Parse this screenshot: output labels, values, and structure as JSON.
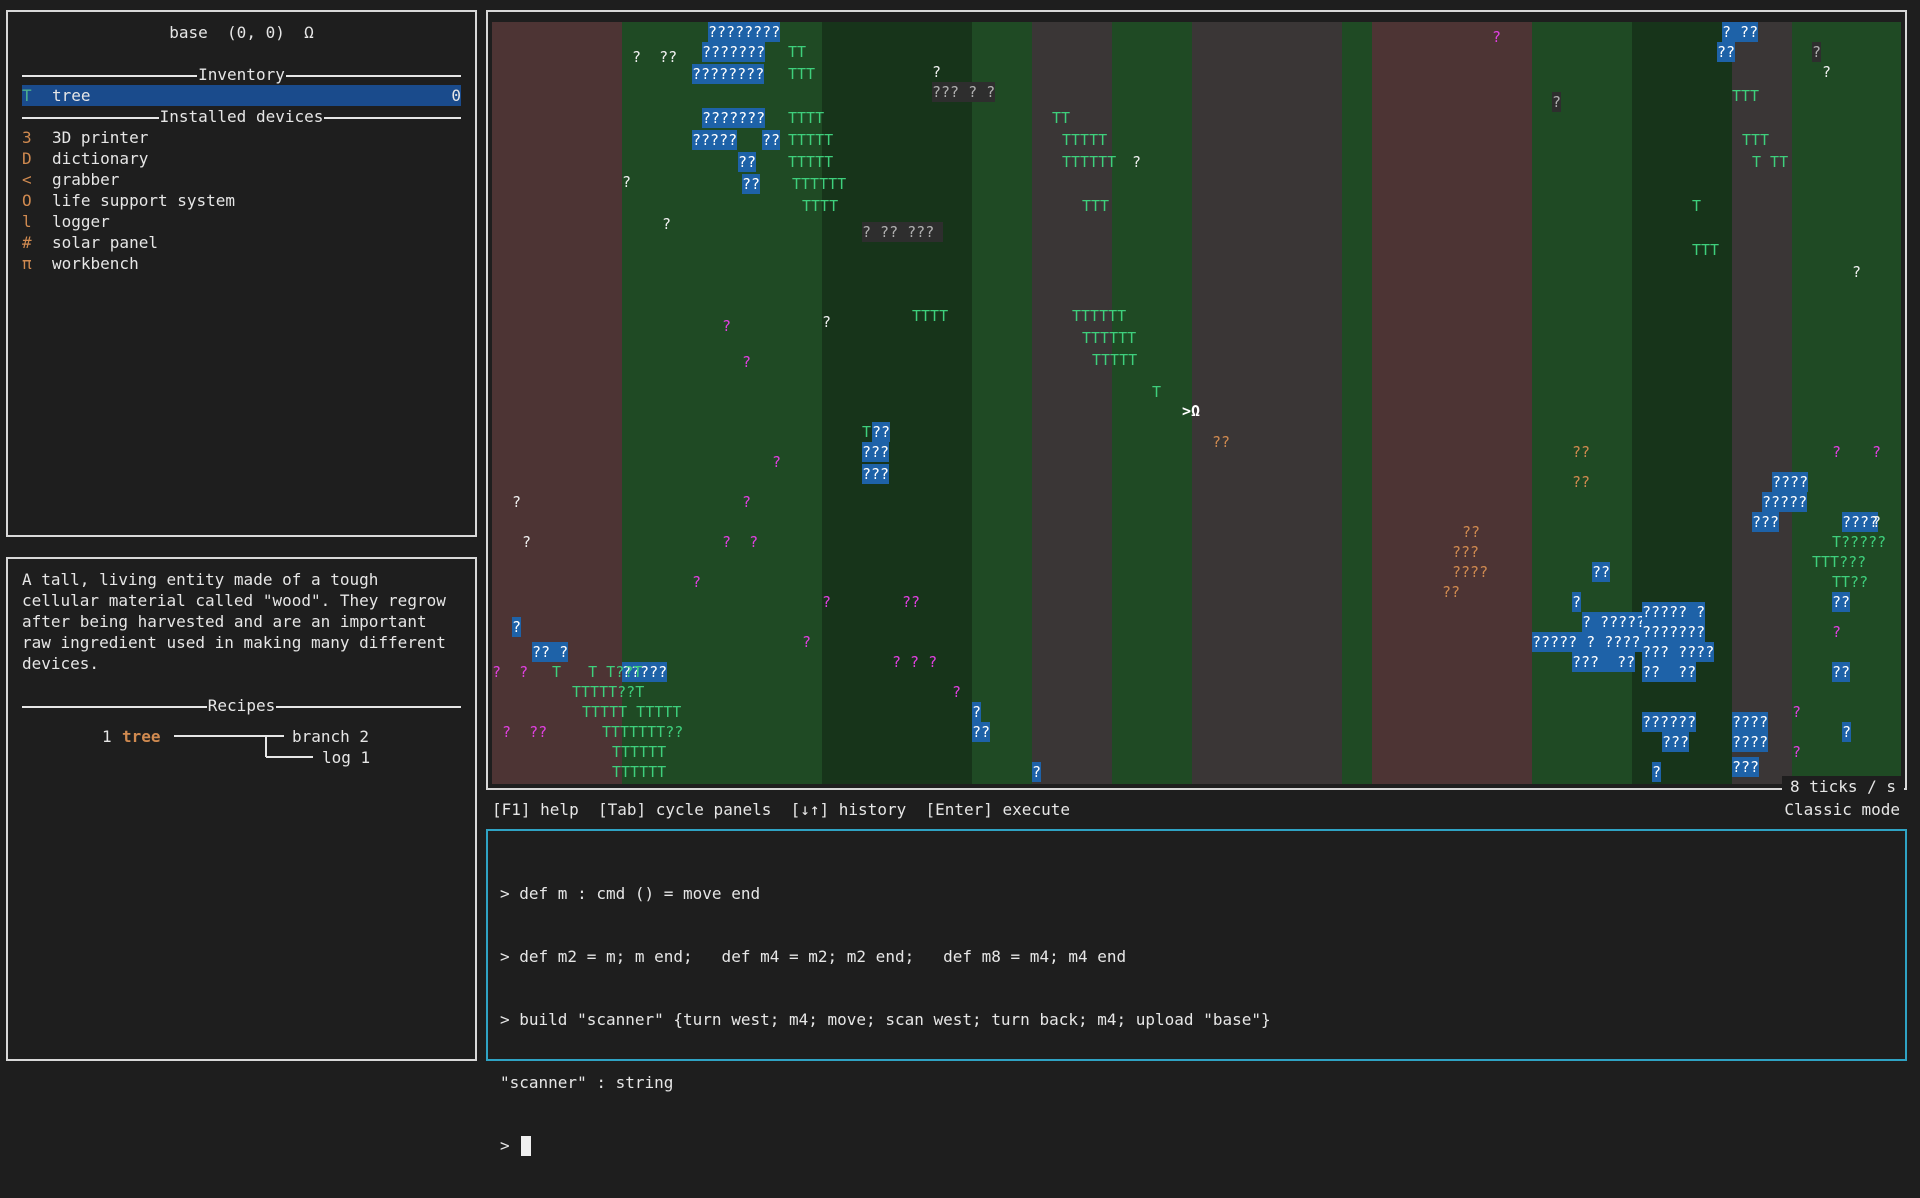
{
  "robot": {
    "title": "base  (0, 0)  Ω"
  },
  "inventory": {
    "header": "Inventory",
    "items": [
      {
        "glyph": "T",
        "name": "tree",
        "count": "0"
      }
    ]
  },
  "devices": {
    "header": "Installed devices",
    "items": [
      {
        "glyph": "3",
        "name": "3D printer",
        "color": "#d08a50"
      },
      {
        "glyph": "D",
        "name": "dictionary",
        "color": "#d08a50"
      },
      {
        "glyph": "<",
        "name": "grabber",
        "color": "#d08a50"
      },
      {
        "glyph": "O",
        "name": "life support system",
        "color": "#d08a50"
      },
      {
        "glyph": "l",
        "name": "logger",
        "color": "#d08a50"
      },
      {
        "glyph": "#",
        "name": "solar panel",
        "color": "#d08a50"
      },
      {
        "glyph": "π",
        "name": "workbench",
        "color": "#d08a50"
      }
    ]
  },
  "info": {
    "description": "A tall, living entity made of a tough\ncellular material called \"wood\". They regrow\nafter being harvested and are an important\nraw ingredient used in making many different\ndevices.",
    "recipes_header": "Recipes",
    "recipe": {
      "input_count": "1",
      "input_name": "tree",
      "outputs": [
        "branch 2",
        "log 1"
      ]
    }
  },
  "world": {
    "robot_marker": ">Ω",
    "colors": {
      "stone": "#3a3636",
      "grass": "#1f4a24",
      "forest": "#17341a",
      "dirt": "#4d3434"
    }
  },
  "status": {
    "ticks": "8 ticks / s",
    "help": "[F1] help  [Tab] cycle panels  [↓↑] history  [Enter] execute",
    "mode": "Classic mode"
  },
  "repl": {
    "lines": [
      "> def m : cmd () = move end",
      "> def m2 = m; m end;   def m4 = m2; m2 end;   def m8 = m4; m4 end",
      "> build \"scanner\" {turn west; m4; move; scan west; turn back; m4; upload \"base\"}",
      "\"scanner\" : string"
    ],
    "prompt": ">"
  }
}
